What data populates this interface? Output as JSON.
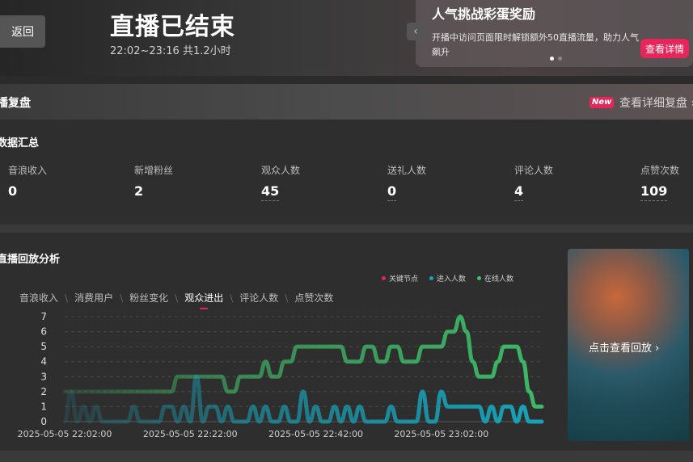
{
  "header": {
    "back_label": "返回",
    "title": "直播已结束",
    "time_text": "22:02~23:16 共1.2小时"
  },
  "promo": {
    "title": "人气挑战彩蛋奖励",
    "description": "开播中访问页面限时解锁额外50直播流量，助力人气飙升",
    "button_label": "查看详情",
    "prev_icon": "chevron-left-icon"
  },
  "review": {
    "title": "播复盘",
    "badge": "New",
    "link_label": "查看详细复盘 ›"
  },
  "summary": {
    "title": "数据汇总",
    "stats": [
      {
        "label": "音浪收入",
        "value": "0"
      },
      {
        "label": "新增粉丝",
        "value": "2"
      },
      {
        "label": "观众人数",
        "value": "45"
      },
      {
        "label": "送礼人数",
        "value": "0"
      },
      {
        "label": "评论人数",
        "value": "4"
      },
      {
        "label": "点赞次数",
        "value": "109"
      }
    ]
  },
  "analysis": {
    "title": "直播回放分析",
    "legend": [
      {
        "label": "关键节点",
        "color": "#e6265a"
      },
      {
        "label": "进入人数",
        "color": "#17a3b8"
      },
      {
        "label": "在线人数",
        "color": "#3fbf6a"
      }
    ],
    "tabs": [
      "音浪收入",
      "消费用户",
      "粉丝变化",
      "观众进出",
      "评论人数",
      "点赞次数"
    ],
    "active_tab": "观众进出",
    "replay_label": "点击查看回放 ›"
  },
  "chart_data": {
    "type": "line",
    "x_tick_labels": [
      "2025-05-05 22:02:00",
      "2025-05-05 22:22:00",
      "2025-05-05 22:42:00",
      "2025-05-05 23:02:00"
    ],
    "x_range_minutes": [
      0,
      76
    ],
    "ylim": [
      0,
      7
    ],
    "y_ticks": [
      0,
      1,
      2,
      3,
      4,
      5,
      6,
      7
    ],
    "grid": true,
    "series": [
      {
        "name": "在线人数",
        "color": "#3fbf6a",
        "x": [
          0,
          1,
          2,
          3,
          4,
          5,
          6,
          7,
          8,
          9,
          10,
          11,
          12,
          13,
          14,
          15,
          16,
          17,
          18,
          19,
          20,
          21,
          22,
          23,
          24,
          25,
          26,
          27,
          28,
          29,
          30,
          31,
          32,
          33,
          34,
          35,
          36,
          37,
          38,
          39,
          40,
          41,
          42,
          43,
          44,
          45,
          46,
          47,
          48,
          49,
          50,
          51,
          52,
          53,
          54,
          55,
          56,
          57,
          58,
          59,
          60,
          61,
          62,
          63,
          64,
          65,
          66,
          67,
          68,
          69,
          70,
          71,
          72,
          73,
          74,
          75,
          76
        ],
        "values": [
          2,
          2,
          2,
          2,
          2,
          2,
          2,
          2,
          2,
          2,
          2,
          2,
          2,
          2,
          2,
          2,
          2,
          2,
          3,
          3,
          3,
          3,
          3,
          3,
          3,
          3,
          2,
          2,
          3,
          3,
          3,
          3,
          4,
          3,
          3,
          4,
          4,
          5,
          5,
          5,
          5,
          5,
          5,
          5,
          5,
          4,
          4,
          4,
          5,
          5,
          4,
          4,
          5,
          5,
          4,
          4,
          4,
          5,
          5,
          5,
          5,
          6,
          6,
          7,
          6,
          4,
          3,
          3,
          3,
          4,
          5,
          5,
          5,
          4,
          2,
          1,
          1
        ]
      },
      {
        "name": "进入人数",
        "color": "#17a3b8",
        "x": [
          0,
          1,
          2,
          3,
          4,
          5,
          6,
          7,
          8,
          9,
          10,
          11,
          12,
          13,
          14,
          15,
          16,
          17,
          18,
          19,
          20,
          21,
          22,
          23,
          24,
          25,
          26,
          27,
          28,
          29,
          30,
          31,
          32,
          33,
          34,
          35,
          36,
          37,
          38,
          39,
          40,
          41,
          42,
          43,
          44,
          45,
          46,
          47,
          48,
          49,
          50,
          51,
          52,
          53,
          54,
          55,
          56,
          57,
          58,
          59,
          60,
          61,
          62,
          63,
          64,
          65,
          66,
          67,
          68,
          69,
          70,
          71,
          72,
          73,
          74,
          75,
          76
        ],
        "values": [
          0,
          2,
          0,
          1,
          0,
          1,
          0,
          0,
          0,
          0,
          0,
          1,
          0,
          0,
          0,
          0,
          1,
          1,
          0,
          1,
          0,
          3,
          0,
          1,
          1,
          0,
          1,
          0,
          0,
          0,
          1,
          0,
          1,
          0,
          0,
          1,
          0,
          0,
          2,
          0,
          1,
          0,
          0,
          1,
          0,
          1,
          0,
          1,
          0,
          0,
          0,
          0,
          1,
          0,
          0,
          0,
          0,
          2,
          0,
          0,
          2,
          1,
          1,
          1,
          1,
          1,
          1,
          0,
          1,
          0,
          1,
          1,
          0,
          1,
          0,
          0,
          0
        ]
      }
    ]
  }
}
